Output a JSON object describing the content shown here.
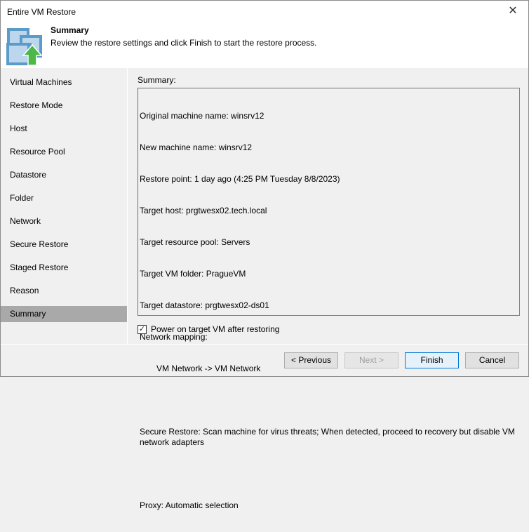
{
  "window": {
    "title": "Entire VM Restore"
  },
  "header": {
    "title": "Summary",
    "description": "Review the restore settings and click Finish to start the restore process."
  },
  "nav": {
    "items": [
      {
        "label": "Virtual Machines"
      },
      {
        "label": "Restore Mode"
      },
      {
        "label": "Host"
      },
      {
        "label": "Resource Pool"
      },
      {
        "label": "Datastore"
      },
      {
        "label": "Folder"
      },
      {
        "label": "Network"
      },
      {
        "label": "Secure Restore"
      },
      {
        "label": "Staged Restore"
      },
      {
        "label": "Reason"
      },
      {
        "label": "Summary"
      }
    ],
    "selected": "Summary"
  },
  "summary": {
    "label": "Summary:",
    "lines": [
      "Original machine name: winsrv12",
      "New machine name: winsrv12",
      "Restore point: 1 day ago (4:25 PM Tuesday 8/8/2023)",
      "Target host: prgtwesx02.tech.local",
      "Target resource pool: Servers",
      "Target VM folder: PragueVM",
      "Target datastore: prgtwesx02-ds01",
      "Network mapping:",
      "VM Network -> VM Network",
      "",
      "Secure Restore: Scan machine for virus threats; When detected, proceed to recovery but disable VM network adapters",
      "",
      "Proxy: Automatic selection"
    ]
  },
  "power_on": {
    "label": "Power on target VM after restoring",
    "checked": true
  },
  "buttons": {
    "previous": "< Previous",
    "next": "Next >",
    "finish": "Finish",
    "cancel": "Cancel"
  }
}
